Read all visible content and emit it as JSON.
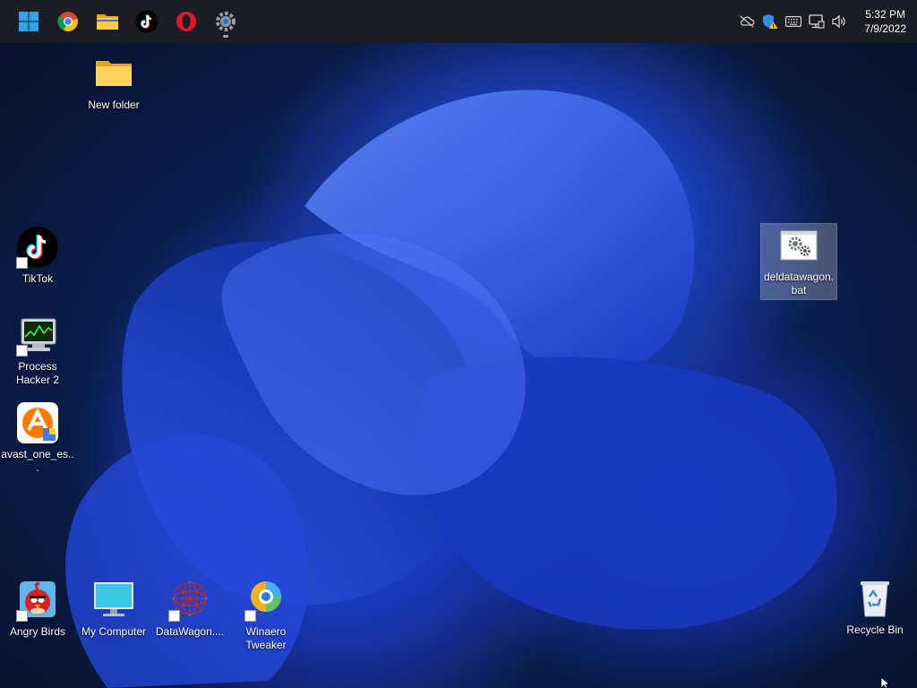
{
  "taskbar": {
    "apps": [
      {
        "id": "start",
        "icon": "windows-logo-icon"
      },
      {
        "id": "chrome",
        "icon": "chrome-icon"
      },
      {
        "id": "explorer",
        "icon": "folder-icon"
      },
      {
        "id": "tiktok",
        "icon": "tiktok-icon"
      },
      {
        "id": "opera",
        "icon": "opera-icon"
      },
      {
        "id": "settings",
        "icon": "gear-icon",
        "active": true
      }
    ],
    "tray": {
      "icons": [
        "onedrive-offline-icon",
        "defender-warning-icon",
        "keyboard-icon",
        "network-icon",
        "volume-icon"
      ],
      "time": "5:32 PM",
      "date": "7/9/2022"
    }
  },
  "desktop": {
    "icons": {
      "new_folder": "New folder",
      "tiktok": "TikTok",
      "process_hacker": "Process Hacker 2",
      "avast": "avast_one_es...",
      "angry_birds": "Angry Birds",
      "my_computer": "My Computer",
      "datawagon": "DataWagon....",
      "winaero": "Winaero Tweaker",
      "deldatawagon": "deldatawagon.bat",
      "recycle_bin": "Recycle Bin"
    }
  },
  "colors": {
    "taskbar_bg": "#1b1d22",
    "wallpaper_accent": "#2a55e6",
    "selection": "#ffffff40"
  }
}
